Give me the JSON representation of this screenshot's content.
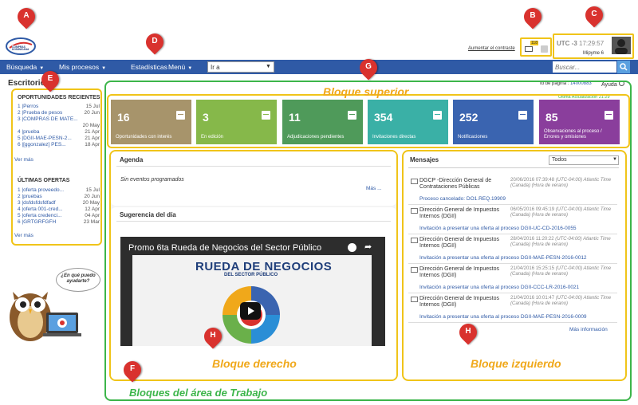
{
  "header": {
    "logo_text": "COMPRAS DOMINICANA",
    "contrast_link": "Aumentar el contraste",
    "notification_count": "118",
    "utc_label": "UTC -3",
    "time": "17:29:57",
    "username": "Mipyme 6"
  },
  "nav": {
    "items": [
      "Búsqueda",
      "Mis procesos",
      "Estadísticas",
      "Menú"
    ],
    "goto_value": "Ir a",
    "search_placeholder": "Buscar..."
  },
  "markers": [
    "A",
    "B",
    "C",
    "D",
    "E",
    "F",
    "G",
    "H",
    "H"
  ],
  "page": {
    "title": "Escritorio",
    "page_id_label": "Id de página :",
    "page_id": "14000883",
    "help": "Ayuda",
    "last_update": "Última Actualización 21:29"
  },
  "sidebar": {
    "opportunities_title": "OPORTUNIDADES RECIENTES",
    "opportunities": [
      {
        "text": "1 |Perros",
        "date": "15 Jul"
      },
      {
        "text": "2 |Prueba de pesos",
        "date": "20 Jun"
      },
      {
        "text": "3 |COMPRAS DE MATE...",
        "date": ""
      },
      {
        "text": "",
        "date": "20 May"
      },
      {
        "text": "4 |prueba",
        "date": "21 Apr"
      },
      {
        "text": "5 |DGII-MAE-PESN-2...",
        "date": "21 Apr"
      },
      {
        "text": "6 |[ggonzalez] PES...",
        "date": "18 Apr"
      }
    ],
    "opportunities_more": "Ver más",
    "offers_title": "ÚLTIMAS OFERTAS",
    "offers": [
      {
        "text": "1 |oferta proveedo...",
        "date": "15 Jul"
      },
      {
        "text": "2 |pruebas",
        "date": "20 Jun"
      },
      {
        "text": "3 |dsfdsfdsfdfadf",
        "date": "20 May"
      },
      {
        "text": "4 |oferta 001-cred...",
        "date": "12 Apr"
      },
      {
        "text": "5 |oferta credenci...",
        "date": "04 Apr"
      },
      {
        "text": "6 |GRTGRFGFH",
        "date": "23 Mar"
      }
    ],
    "offers_more": "Ver más"
  },
  "cards": [
    {
      "num": "16",
      "label": "Oportunidades con interés",
      "color": "#a7946b"
    },
    {
      "num": "3",
      "label": "En edición",
      "color": "#86b84a"
    },
    {
      "num": "11",
      "label": "Adjudicaciones pendientes",
      "color": "#4f9a5a"
    },
    {
      "num": "354",
      "label": "Invitaciones directas",
      "color": "#3ab0a6"
    },
    {
      "num": "252",
      "label": "Notificaciones",
      "color": "#3a64b0"
    },
    {
      "num": "85",
      "label": "Observaciones al proceso / Errores y omisiones",
      "color": "#8a3e9c"
    }
  ],
  "agenda": {
    "title": "Agenda",
    "empty": "Sin eventos programados",
    "more": "Más ..."
  },
  "suggestion": {
    "title": "Sugerencia del día",
    "video_title": "Promo 6ta Rueda de Negocios del Sector Público",
    "image_title": "RUEDA DE NEGOCIOS",
    "image_subtitle": "DEL SECTOR PÚBLICO"
  },
  "messages": {
    "title": "Mensajes",
    "filter": "Todos",
    "items": [
      {
        "from": "DGCP -Dirección General de Contrataciones Públicas",
        "time": "20/06/2016 07:39:48",
        "tz": "(UTC-04:00) Atlantic Time (Canada) (Hora de verano)",
        "link": "Proceso cancelado: DO1.REQ.19909"
      },
      {
        "from": "Dirección General de Impuestos Internos (DGII)",
        "time": "06/05/2016 09:45:19",
        "tz": "(UTC-04:00) Atlantic Time (Canada) (Hora de verano)",
        "link": "Invitación a presentar una oferta al proceso DGII-UC-CD-2016-0055"
      },
      {
        "from": "Dirección General de Impuestos Internos (DGII)",
        "time": "28/04/2016 11:20:22",
        "tz": "(UTC-04:00) Atlantic Time (Canada) (Hora de verano)",
        "link": "Invitación a presentar una oferta al proceso DGII-MAE-PESN-2016-0012"
      },
      {
        "from": "Dirección General de Impuestos Internos (DGII)",
        "time": "21/04/2016 15:25:15",
        "tz": "(UTC-04:00) Atlantic Time (Canada) (Hora de verano)",
        "link": "Invitación a presentar una oferta al proceso DGII-CCC-LR-2016-0021"
      },
      {
        "from": "Dirección General de Impuestos Internos (DGII)",
        "time": "21/04/2016 10:01:47",
        "tz": "(UTC-04:00) Atlantic Time (Canada) (Hora de verano)",
        "link": "Invitación a presentar una oferta al proceso DGII-MAE-PESN-2016-0009"
      }
    ],
    "more": "Más información"
  },
  "annotations": {
    "superior": "Bloque superior",
    "derecho": "Bloque derecho",
    "izquierdo": "Bloque izquierdo",
    "work_area": "Bloques del área de Trabajo",
    "owl_bubble": "¿En qué puedo ayudarte?"
  }
}
